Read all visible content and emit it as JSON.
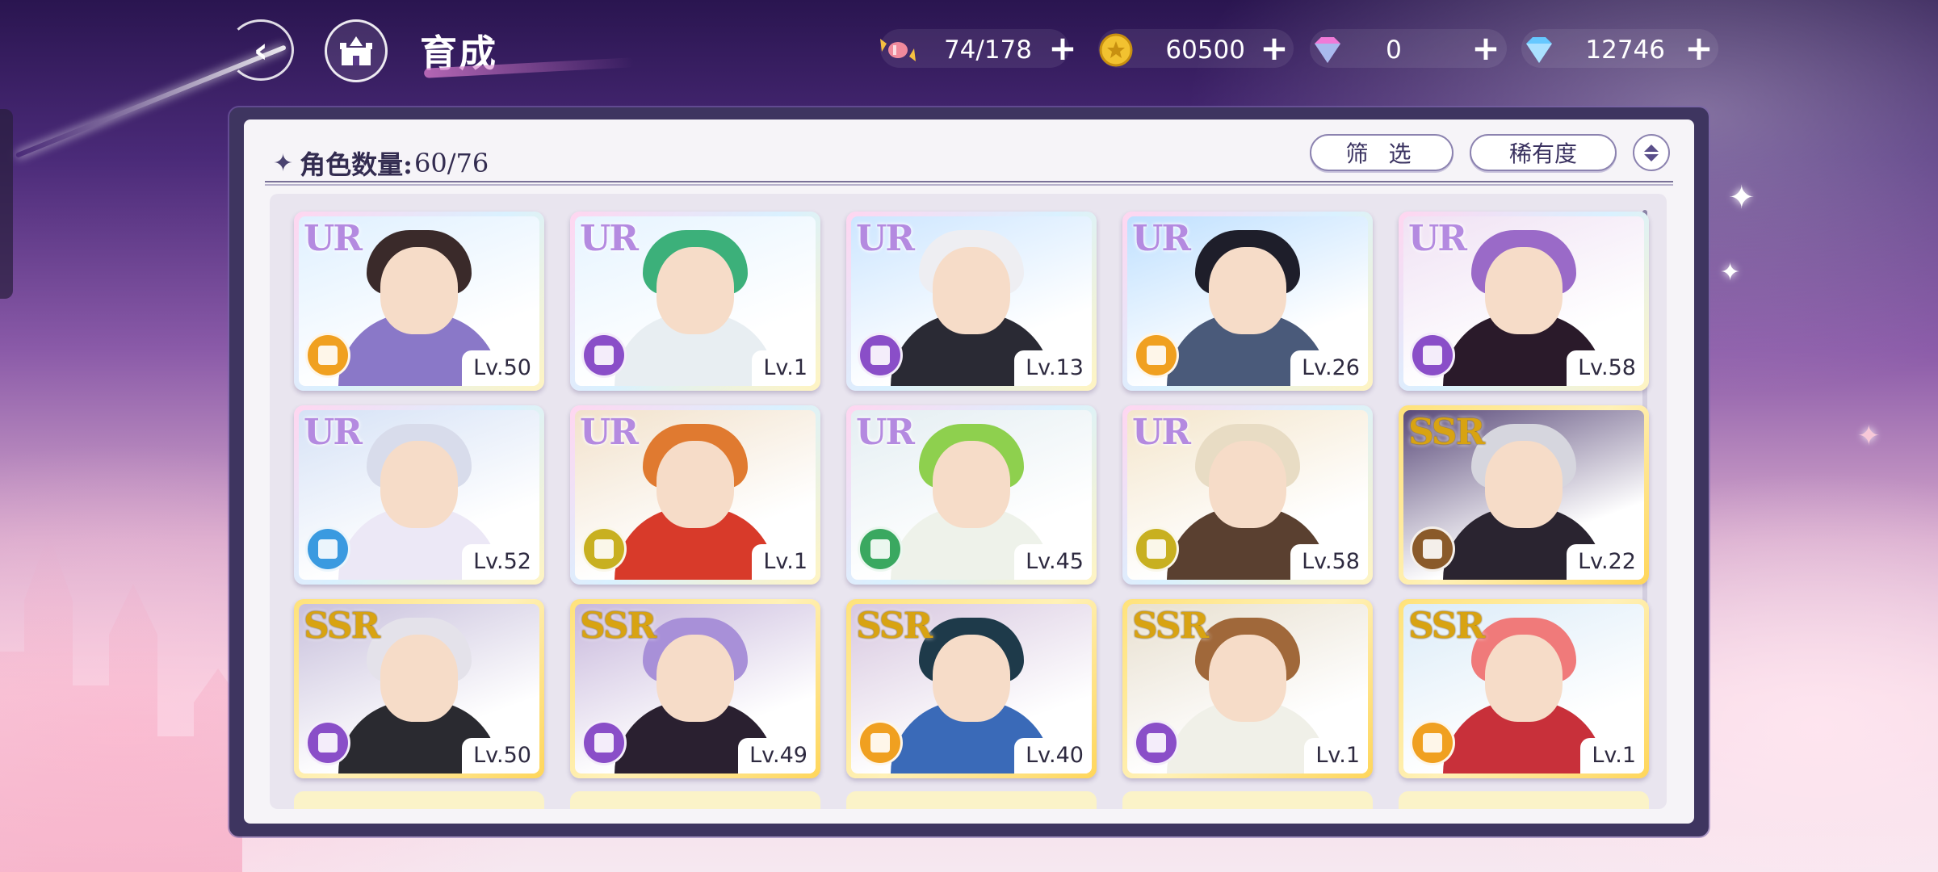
{
  "header": {
    "title": "育成",
    "currencies": [
      {
        "name": "candy",
        "value": "74/178",
        "color": "#f08a9c"
      },
      {
        "name": "gold-coin",
        "value": "60500",
        "color": "#f2c230"
      },
      {
        "name": "pink-diamond",
        "value": "0",
        "color": "#f07ad8"
      },
      {
        "name": "blue-diamond",
        "value": "12746",
        "color": "#66c8ff"
      }
    ]
  },
  "panel": {
    "count_label": "角色数量:",
    "count_value": "60/76",
    "filter_label": "筛 选",
    "rarity_label": "稀有度"
  },
  "cards": [
    {
      "rarity": "UR",
      "level": "Lv.50",
      "attr_color": "#f0a020",
      "hair": "#3a2a2a",
      "body": "#8a78c8",
      "bg": "#dff0ff"
    },
    {
      "rarity": "UR",
      "level": "Lv.1",
      "attr_color": "#8a4ec8",
      "hair": "#3cb07a",
      "body": "#e8eef2",
      "bg": "#e6f4ff"
    },
    {
      "rarity": "UR",
      "level": "Lv.13",
      "attr_color": "#8a4ec8",
      "hair": "#eeeef2",
      "body": "#2a2a34",
      "bg": "#cde6ff"
    },
    {
      "rarity": "UR",
      "level": "Lv.26",
      "attr_color": "#f0a020",
      "hair": "#1e1e2a",
      "body": "#4a5a7a",
      "bg": "#bfe0ff"
    },
    {
      "rarity": "UR",
      "level": "Lv.58",
      "attr_color": "#8a4ec8",
      "hair": "#9a6ac8",
      "body": "#2a1a2a",
      "bg": "#f0e2f4"
    },
    {
      "rarity": "UR",
      "level": "Lv.52",
      "attr_color": "#3a9ae0",
      "hair": "#d8dceb",
      "body": "#ece8f6",
      "bg": "#d6e2f6"
    },
    {
      "rarity": "UR",
      "level": "Lv.1",
      "attr_color": "#c8b020",
      "hair": "#e07a30",
      "body": "#d83a2a",
      "bg": "#f2e2cc"
    },
    {
      "rarity": "UR",
      "level": "Lv.45",
      "attr_color": "#3aa860",
      "hair": "#8ed04e",
      "body": "#eef2ea",
      "bg": "#e4eef2"
    },
    {
      "rarity": "UR",
      "level": "Lv.58",
      "attr_color": "#c8b020",
      "hair": "#e8dcc4",
      "body": "#5a4030",
      "bg": "#f4e6cc"
    },
    {
      "rarity": "SSR",
      "level": "Lv.22",
      "attr_color": "#8a5a2a",
      "hair": "#d6d6de",
      "body": "#2a2430",
      "bg": "#5a4a7a"
    },
    {
      "rarity": "SSR",
      "level": "Lv.50",
      "attr_color": "#8a4ec8",
      "hair": "#e4e2ea",
      "body": "#2a2a30",
      "bg": "#c8c0dc"
    },
    {
      "rarity": "SSR",
      "level": "Lv.49",
      "attr_color": "#8a4ec8",
      "hair": "#a890d8",
      "body": "#2a2030",
      "bg": "#c8b8dc"
    },
    {
      "rarity": "SSR",
      "level": "Lv.40",
      "attr_color": "#f0a020",
      "hair": "#1e3a4a",
      "body": "#3a6ab8",
      "bg": "#d8c8e0"
    },
    {
      "rarity": "SSR",
      "level": "Lv.1",
      "attr_color": "#8a4ec8",
      "hair": "#a0683a",
      "body": "#f0f0e8",
      "bg": "#e8e0d0"
    },
    {
      "rarity": "SSR",
      "level": "Lv.1",
      "attr_color": "#f0a020",
      "hair": "#f07a7a",
      "body": "#c8303a",
      "bg": "#dcecf8"
    }
  ]
}
